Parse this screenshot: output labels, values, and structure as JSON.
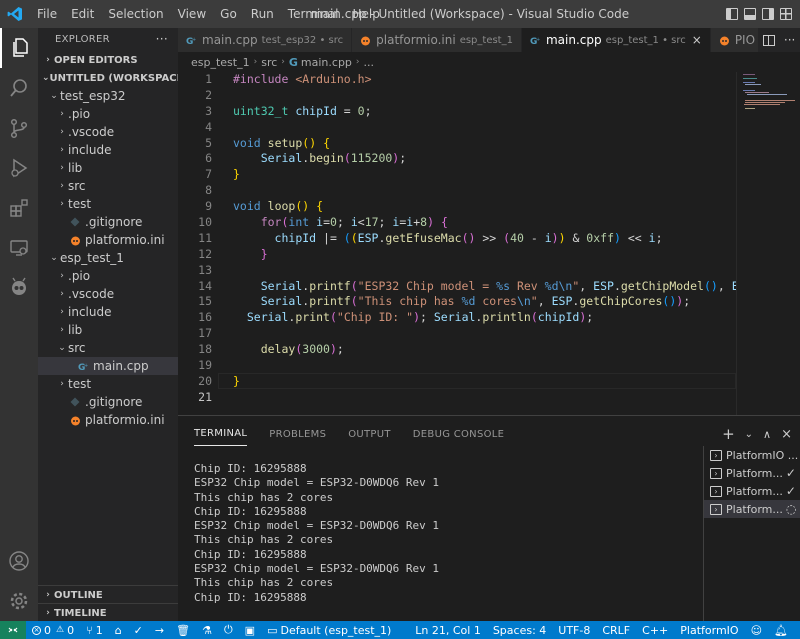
{
  "titlebar": {
    "menu": [
      "File",
      "Edit",
      "Selection",
      "View",
      "Go",
      "Run",
      "Terminal",
      "Help"
    ],
    "title": "main.cpp - Untitled (Workspace) - Visual Studio Code"
  },
  "activity": [
    "explorer-icon",
    "search-icon",
    "source-control-icon",
    "run-debug-icon",
    "extensions-icon",
    "remote-explorer-icon",
    "platformio-icon",
    "account-icon",
    "settings-gear-icon"
  ],
  "sidebar": {
    "header": "EXPLORER",
    "open_editors": "OPEN EDITORS",
    "workspace": "UNTITLED (WORKSPACE)",
    "tree": [
      {
        "label": "test_esp32",
        "type": "folder-open",
        "level": 1
      },
      {
        "label": ".pio",
        "type": "folder",
        "level": 2
      },
      {
        "label": ".vscode",
        "type": "folder",
        "level": 2
      },
      {
        "label": "include",
        "type": "folder",
        "level": 2
      },
      {
        "label": "lib",
        "type": "folder",
        "level": 2
      },
      {
        "label": "src",
        "type": "folder",
        "level": 2
      },
      {
        "label": "test",
        "type": "folder",
        "level": 2
      },
      {
        "label": ".gitignore",
        "type": "git",
        "level": 2
      },
      {
        "label": "platformio.ini",
        "type": "pio",
        "level": 2
      },
      {
        "label": "esp_test_1",
        "type": "folder-open",
        "level": 1
      },
      {
        "label": ".pio",
        "type": "folder",
        "level": 2
      },
      {
        "label": ".vscode",
        "type": "folder",
        "level": 2
      },
      {
        "label": "include",
        "type": "folder",
        "level": 2
      },
      {
        "label": "lib",
        "type": "folder",
        "level": 2
      },
      {
        "label": "src",
        "type": "folder-open",
        "level": 2
      },
      {
        "label": "main.cpp",
        "type": "cpp",
        "level": 3,
        "selected": true
      },
      {
        "label": "test",
        "type": "folder",
        "level": 2
      },
      {
        "label": ".gitignore",
        "type": "git",
        "level": 2
      },
      {
        "label": "platformio.ini",
        "type": "pio",
        "level": 2
      }
    ],
    "outline": "OUTLINE",
    "timeline": "TIMELINE"
  },
  "tabs": [
    {
      "label": "main.cpp",
      "desc": "test_esp32 • src",
      "icon": "cpp",
      "active": false
    },
    {
      "label": "platformio.ini",
      "desc": "esp_test_1",
      "icon": "pio",
      "active": false
    },
    {
      "label": "main.cpp",
      "desc": "esp_test_1 • src",
      "icon": "cpp",
      "active": true,
      "close": "×"
    },
    {
      "label": "PIO Ho",
      "desc": "",
      "icon": "pio",
      "active": false
    }
  ],
  "breadcrumb": [
    "esp_test_1",
    "src",
    "main.cpp",
    "..."
  ],
  "editor": {
    "line_numbers": [
      "1",
      "2",
      "3",
      "4",
      "5",
      "6",
      "7",
      "8",
      "9",
      "10",
      "11",
      "12",
      "13",
      "14",
      "15",
      "16",
      "17",
      "18",
      "19",
      "20",
      "21"
    ],
    "current_line": "21"
  },
  "panel": {
    "tabs": [
      "TERMINAL",
      "PROBLEMS",
      "OUTPUT",
      "DEBUG CONSOLE"
    ],
    "terminal_lines": [
      "Chip ID: 16295888",
      "ESP32 Chip model = ESP32-D0WDQ6 Rev 1",
      "This chip has 2 cores",
      "Chip ID: 16295888",
      "ESP32 Chip model = ESP32-D0WDQ6 Rev 1",
      "This chip has 2 cores",
      "Chip ID: 16295888",
      "ESP32 Chip model = ESP32-D0WDQ6 Rev 1",
      "This chip has 2 cores",
      "Chip ID: 16295888"
    ],
    "terminals": [
      {
        "label": "PlatformIO ...",
        "status": ""
      },
      {
        "label": "Platform...",
        "status": "✓"
      },
      {
        "label": "Platform...",
        "status": "✓"
      },
      {
        "label": "Platform...",
        "status": "◌",
        "selected": true
      }
    ]
  },
  "statusbar": {
    "errors": "0",
    "warnings": "0",
    "branch_count": "1",
    "env": "Default (esp_test_1)",
    "position": "Ln 21, Col 1",
    "spaces": "Spaces: 4",
    "encoding": "UTF-8",
    "eol": "CRLF",
    "language": "C++",
    "platform": "PlatformIO"
  },
  "colors": {
    "accent": "#007acc",
    "remote": "#16825d",
    "sidebar": "#252526",
    "activity": "#333333"
  }
}
